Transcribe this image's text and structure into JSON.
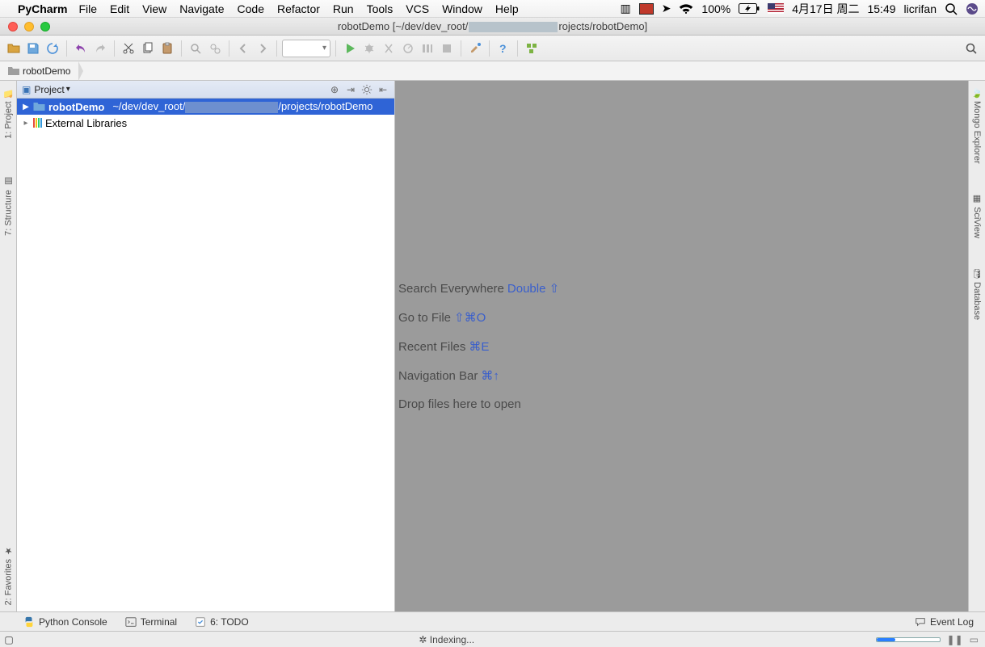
{
  "mac_menu": {
    "app_name": "PyCharm",
    "items": [
      "File",
      "Edit",
      "View",
      "Navigate",
      "Code",
      "Refactor",
      "Run",
      "Tools",
      "VCS",
      "Window",
      "Help"
    ],
    "battery": "100%",
    "date": "4月17日 周二",
    "time": "15:49",
    "user": "licrifan"
  },
  "window": {
    "title_prefix": "robotDemo [~/dev/dev_root/",
    "title_suffix": "rojects/robotDemo]"
  },
  "breadcrumb": {
    "root": "robotDemo"
  },
  "project_panel": {
    "title": "Project",
    "tree": {
      "root_name": "robotDemo",
      "root_path_prefix": "~/dev/dev_root/",
      "root_path_suffix": "/projects/robotDemo",
      "external_libs": "External Libraries"
    }
  },
  "left_tabs": {
    "project": "1: Project",
    "structure": "7: Structure",
    "favorites": "2: Favorites"
  },
  "right_tabs": {
    "mongo": "Mongo Explorer",
    "sciview": "SciView",
    "database": "Database"
  },
  "editor_hints": {
    "search": {
      "label": "Search Everywhere",
      "shortcut": "Double ⇧"
    },
    "goto": {
      "label": "Go to File",
      "shortcut": "⇧⌘O"
    },
    "recent": {
      "label": "Recent Files",
      "shortcut": "⌘E"
    },
    "navbar": {
      "label": "Navigation Bar",
      "shortcut": "⌘↑"
    },
    "drop": {
      "label": "Drop files here to open"
    }
  },
  "bottom_tabs": {
    "py": "Python Console",
    "term": "Terminal",
    "todo": "6: TODO",
    "eventlog": "Event Log"
  },
  "status": {
    "indexing": "Indexing..."
  }
}
